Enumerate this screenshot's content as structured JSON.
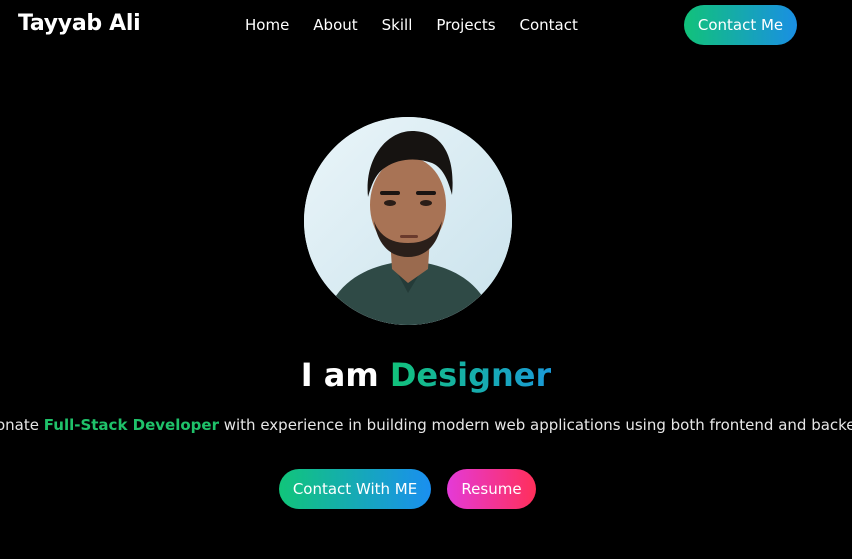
{
  "nav": {
    "brand": "Tayyab Ali",
    "links": [
      "Home",
      "About",
      "Skill",
      "Projects",
      "Contact"
    ],
    "cta": "Contact Me"
  },
  "hero": {
    "headline_prefix": "I am",
    "headline_role": "Designer",
    "tagline_before": "onate ",
    "tagline_highlight": "Full-Stack Developer",
    "tagline_after": " with experience in building modern web applications using both frontend and backend techno",
    "buttons": {
      "contact": "Contact With ME",
      "resume": "Resume"
    }
  },
  "colors": {
    "background": "#000000",
    "accent_green": "#11c27a",
    "accent_blue": "#1a8fe3",
    "accent_pink": "#e43ad8",
    "accent_red": "#ff2f5a"
  },
  "icons": {
    "avatar": "profile-photo"
  }
}
